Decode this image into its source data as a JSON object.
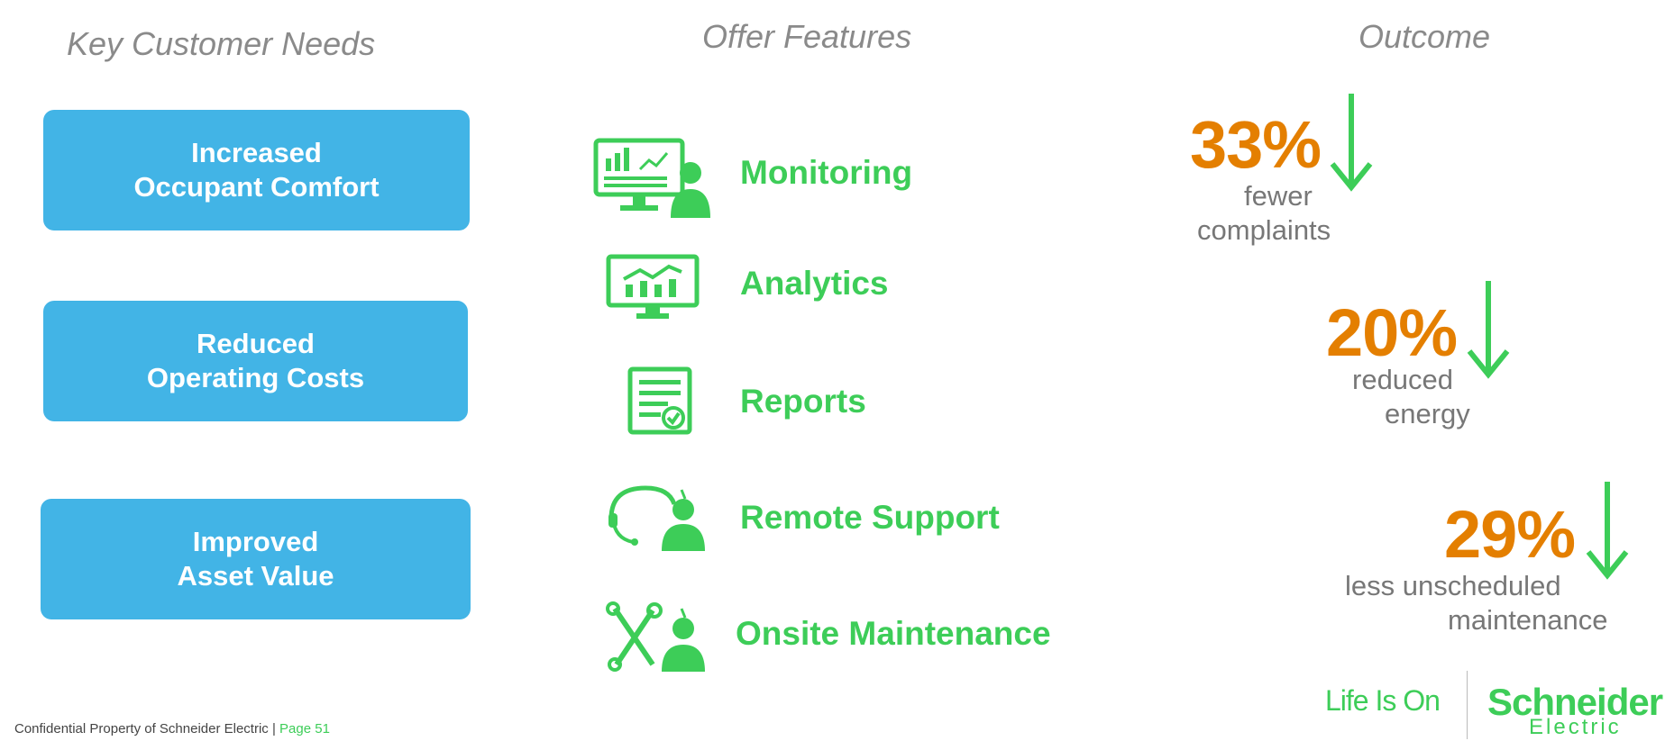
{
  "headers": {
    "needs": "Key Customer Needs",
    "features": "Offer Features",
    "outcome": "Outcome"
  },
  "needs": [
    {
      "line1": "Increased",
      "line2": "Occupant Comfort"
    },
    {
      "line1": "Reduced",
      "line2": "Operating Costs"
    },
    {
      "line1": "Improved",
      "line2": "Asset Value"
    }
  ],
  "features": [
    {
      "label": "Monitoring",
      "icon": "monitoring-icon"
    },
    {
      "label": "Analytics",
      "icon": "analytics-icon"
    },
    {
      "label": "Reports",
      "icon": "reports-icon"
    },
    {
      "label": "Remote Support",
      "icon": "remote-support-icon"
    },
    {
      "label": "Onsite Maintenance",
      "icon": "onsite-maintenance-icon"
    }
  ],
  "outcomes": [
    {
      "value": "33%",
      "line1": "fewer",
      "line2": "complaints",
      "icon": "down-arrow-icon"
    },
    {
      "value": "20%",
      "line1": "reduced",
      "line2": "energy",
      "icon": "down-arrow-icon"
    },
    {
      "value": "29%",
      "line1": "less unscheduled",
      "line2": "maintenance",
      "icon": "down-arrow-icon"
    }
  ],
  "footer": {
    "text": "Confidential Property of Schneider Electric | ",
    "page": "Page 51"
  },
  "branding": {
    "tagline": "Life Is On",
    "company": "Schneider",
    "company_sub": "Electric"
  },
  "colors": {
    "need_box": "#42b4e6",
    "feature_green": "#3dcd58",
    "outcome_orange": "#e47f00",
    "text_gray": "#777777"
  }
}
